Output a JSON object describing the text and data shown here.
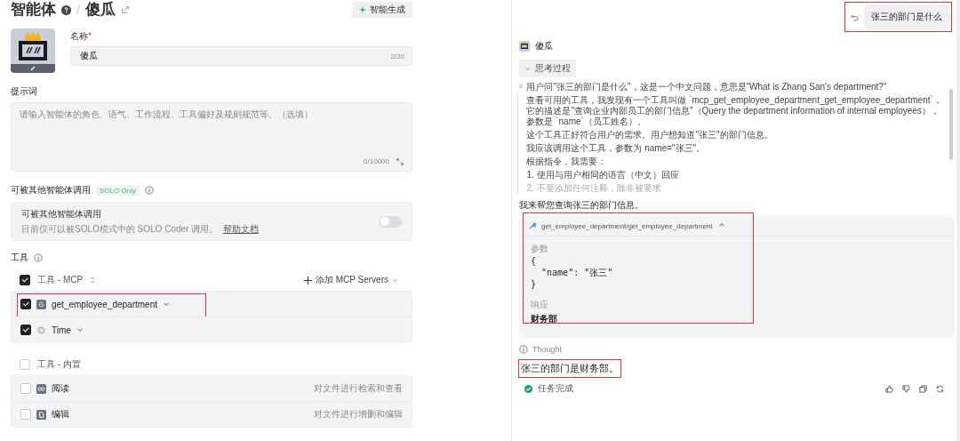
{
  "header": {
    "title": "智能体",
    "separator": "/",
    "agent_name": "傻瓜",
    "generate_button": "智能生成"
  },
  "name_field": {
    "label": "名称",
    "required": "*",
    "value": "傻瓜",
    "counter": "2/20"
  },
  "prompt_field": {
    "label": "提示词",
    "placeholder": "请输入智能体的角色、语气、工作流程、工具偏好及规则规范等。（选填）",
    "counter": "0/10000"
  },
  "callable": {
    "label": "可被其他智能体调用",
    "badge": "SOLO Only",
    "card_title": "可被其他智能体调用",
    "description": "目前仅可以被SOLO模式中的 SOLO Coder 调用。",
    "link": "帮助文档",
    "on": false
  },
  "tools": {
    "label": "工具",
    "groups": [
      {
        "title": "工具 - MCP",
        "checked": true,
        "action": "添加 MCP Servers",
        "items": [
          {
            "kind": "letter",
            "letter": "G",
            "name": "get_employee_department",
            "checked": true,
            "highlighted": true
          },
          {
            "kind": "clock",
            "name": "Time",
            "checked": true,
            "highlighted": false
          }
        ]
      },
      {
        "title": "工具 - 内置",
        "checked": false,
        "items": [
          {
            "kind": "glasses",
            "name": "阅读",
            "description": "对文件进行检索和查看",
            "checked": false,
            "highlighted": false
          },
          {
            "kind": "doc",
            "name": "编辑",
            "description": "对文件进行增删和编辑",
            "checked": false,
            "highlighted": false
          }
        ]
      }
    ]
  },
  "chat": {
    "user_message": {
      "text": "张三的部门是什么",
      "highlighted": true
    },
    "agent_name": "傻瓜",
    "thinking": {
      "label": "思考过程",
      "expanded": true,
      "paragraphs": [
        "用户问\"张三的部门是什么\"，这是一个中文问题，意思是\"What is Zhang San's department?\"",
        "查看可用的工具，我发现有一个工具叫做 `mcp_get_employee_department_get_employee_department`，它的描述是\"查询企业内部员工的部门信息\"（Query the department information of internal employees），参数是 `name`（员工姓名）。",
        "这个工具正好符合用户的需求。用户想知道\"张三\"的部门信息。",
        "我应该调用这个工具，参数为 name=\"张三\"。",
        "根据指令，我需要："
      ],
      "list": [
        "1. 使用与用户相同的语言（中文）回应",
        "2. 不要添加任何注释，除非被要求"
      ]
    },
    "reply": "我来帮您查询张三的部门信息。",
    "tool_call": {
      "name": "get_employee_department/get_employee_department",
      "expanded": true,
      "highlighted": true,
      "params_label": "参数",
      "params": [
        "{",
        "  \"name\": \"张三\"",
        "}"
      ],
      "response_label": "响应",
      "response": "财务部"
    },
    "thought_label": "Thought",
    "answer": {
      "text": "张三的部门是财务部。",
      "highlighted": true
    },
    "status": "任务完成"
  }
}
